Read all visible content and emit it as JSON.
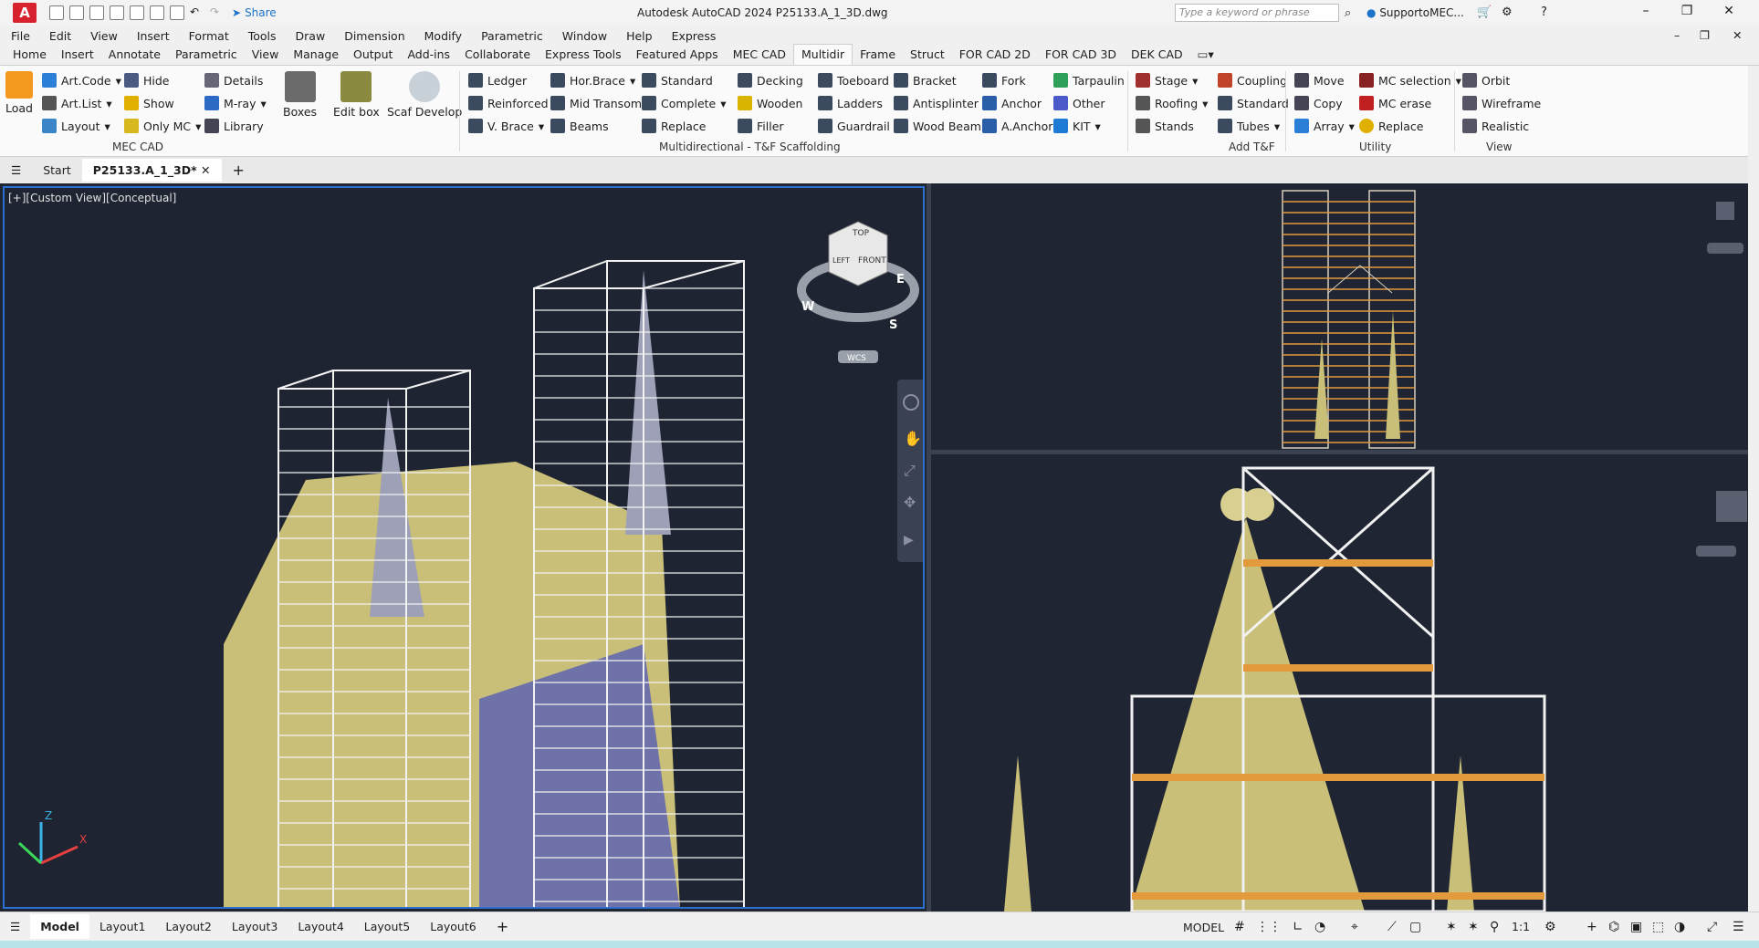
{
  "titlebar": {
    "app_letter": "A",
    "share_label": "Share",
    "title": "Autodesk AutoCAD 2024    P25133.A_1_3D.dwg",
    "search_placeholder": "Type a keyword or phrase",
    "user": "SupportoMEC..."
  },
  "menu": [
    "File",
    "Edit",
    "View",
    "Insert",
    "Format",
    "Tools",
    "Draw",
    "Dimension",
    "Modify",
    "Parametric",
    "Window",
    "Help",
    "Express"
  ],
  "ribbon_tabs": [
    "Home",
    "Insert",
    "Annotate",
    "Parametric",
    "View",
    "Manage",
    "Output",
    "Add-ins",
    "Collaborate",
    "Express Tools",
    "Featured Apps",
    "MEC CAD",
    "Multidir",
    "Frame",
    "Struct",
    "FOR CAD 2D",
    "FOR CAD 3D",
    "DEK CAD"
  ],
  "ribbon": {
    "load": "Load",
    "art_code": "Art.Code",
    "art_list": "Art.List",
    "layout": "Layout",
    "hide": "Hide",
    "show": "Show",
    "only_mc": "Only MC",
    "details": "Details",
    "m_ray": "M-ray",
    "library": "Library",
    "boxes": "Boxes",
    "edit_box": "Edit box",
    "scaf_develop": "Scaf Develop",
    "panel_mec": "MEC CAD",
    "ledger": "Ledger",
    "reinforced": "Reinforced",
    "v_brace": "V. Brace",
    "hor_brace": "Hor.Brace",
    "mid_transom": "Mid Transom",
    "beams": "Beams",
    "standard": "Standard",
    "complete": "Complete",
    "replace": "Replace",
    "decking": "Decking",
    "wooden": "Wooden",
    "filler": "Filler",
    "toeboard": "Toeboard",
    "ladders": "Ladders",
    "guardrail": "Guardrail",
    "bracket": "Bracket",
    "antisplinter": "Antisplinter",
    "wood_beam": "Wood Beam",
    "fork": "Fork",
    "anchor": "Anchor",
    "a_anchor": "A.Anchor",
    "tarpaulin": "Tarpaulin",
    "other": "Other",
    "kit": "KIT",
    "panel_multi": "Multidirectional - T&F Scaffolding",
    "stage": "Stage",
    "roofing": "Roofing",
    "stands": "Stands",
    "coupling": "Coupling",
    "standard2": "Standard",
    "tubes": "Tubes",
    "panel_add": "Add T&F",
    "move": "Move",
    "copy": "Copy",
    "array": "Array",
    "mc_selection": "MC selection",
    "mc_erase": "MC erase",
    "replace2": "Replace",
    "panel_utility": "Utility",
    "orbit": "Orbit",
    "wireframe": "Wireframe",
    "realistic": "Realistic",
    "panel_view": "View"
  },
  "file_tabs": {
    "start": "Start",
    "active": "P25133.A_1_3D*"
  },
  "viewport": {
    "label": "[+][Custom View][Conceptual]",
    "cube_top": "TOP",
    "cube_front": "FRONT",
    "cube_left": "LEFT",
    "compass_w": "W",
    "compass_s": "S",
    "compass_e": "E",
    "wcs": "WCS",
    "axis_z": "Z",
    "axis_x": "X"
  },
  "layout_tabs": [
    "Model",
    "Layout1",
    "Layout2",
    "Layout3",
    "Layout4",
    "Layout5",
    "Layout6"
  ],
  "status": {
    "model": "MODEL",
    "scale": "1:1"
  },
  "colors": {
    "accent": "#2b6fd1",
    "viewport_bg": "#1e2431",
    "building": "#c9bf78",
    "scaffold": "#f2f2f2",
    "plank": "#e39a3c"
  }
}
